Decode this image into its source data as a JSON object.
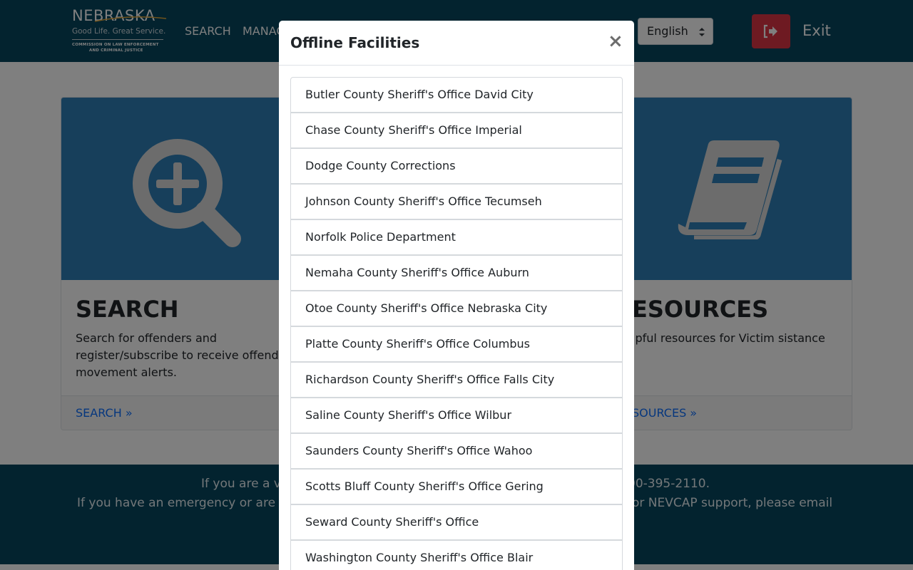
{
  "colors": {
    "nav_bg": "#06465e",
    "card_hero": "#2f7fb6",
    "exit_btn": "#dc3545",
    "link": "#0d6efd"
  },
  "logo": {
    "title": "NEBRASKA",
    "tagline": "Good Life. Great Service.",
    "line1": "COMMISSION ON LAW ENFORCEMENT",
    "line2": "AND CRIMINAL JUSTICE"
  },
  "nav": {
    "links": [
      {
        "label": "SEARCH"
      },
      {
        "label": "MANAG"
      }
    ],
    "language": {
      "selected": "English"
    },
    "exit_icon": "sign-out-icon",
    "exit_label": "Exit"
  },
  "cards": {
    "search": {
      "icon": "search-plus-icon",
      "title": "SEARCH",
      "text": "Search for offenders and register/subscribe to receive offend movement alerts.",
      "link": "SEARCH »"
    },
    "resources": {
      "icon": "book-icon",
      "title": "ESOURCES",
      "text": "lpful resources for Victim sistance",
      "link": "SOURCES »"
    }
  },
  "footer": {
    "line1_left": "If you are a v",
    "line1_right": "00-395-2110.",
    "line2_left": "If you have an emergency or are",
    "line2_right": "for NEVCAP support, please email"
  },
  "modal": {
    "title": "Offline Facilities",
    "close_label": "×",
    "facilities": [
      "Butler County Sheriff's Office David City",
      "Chase County Sheriff's Office Imperial",
      "Dodge County Corrections",
      "Johnson County Sheriff's Office Tecumseh",
      "Norfolk Police Department",
      "Nemaha County Sheriff's Office Auburn",
      "Otoe County Sheriff's Office Nebraska City",
      "Platte County Sheriff's Office Columbus",
      "Richardson County Sheriff's Office Falls City",
      "Saline County Sheriff's Office Wilbur",
      "Saunders County Sheriff's Office Wahoo",
      "Scotts Bluff County Sheriff's Office Gering",
      "Seward County Sheriff's Office",
      "Washington County Sheriff's Office Blair"
    ]
  }
}
